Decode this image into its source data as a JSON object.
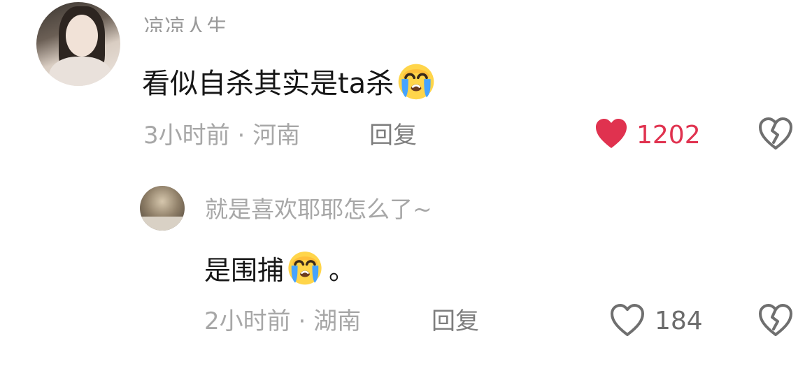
{
  "comments": [
    {
      "username": "凉凉人生",
      "text": "看似自杀其实是ta杀",
      "emoji": "loudly-crying-face",
      "time": "3小时前",
      "separator": "·",
      "location": "河南",
      "reply_label": "回复",
      "likes": "1202",
      "liked": true,
      "like_color": "#e0324f"
    }
  ],
  "replies": [
    {
      "username": "就是喜欢耶耶怎么了~",
      "text": "是围捕",
      "emoji": "loudly-crying-face",
      "text_tail": "。",
      "time": "2小时前",
      "separator": "·",
      "location": "湖南",
      "reply_label": "回复",
      "likes": "184",
      "liked": false
    }
  ],
  "icons": {
    "like_filled": "heart-filled-icon",
    "like_outline": "heart-outline-icon",
    "dislike": "broken-heart-icon",
    "emoji": "loudly-crying-face-icon"
  }
}
